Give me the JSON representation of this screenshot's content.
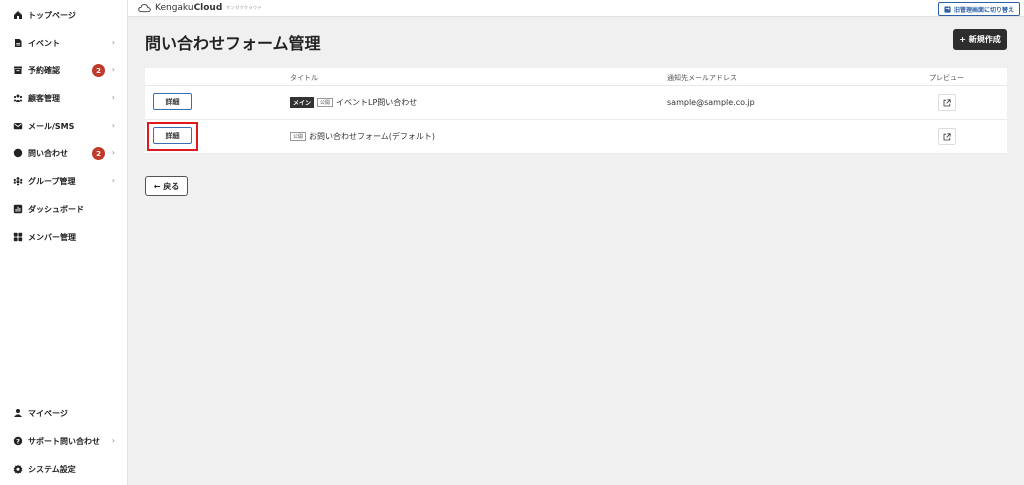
{
  "sidebar": {
    "items": [
      {
        "label": "トップページ",
        "icon": "home-icon"
      },
      {
        "label": "イベント",
        "icon": "document-icon"
      },
      {
        "label": "予約確認",
        "icon": "box-icon",
        "badge": "2"
      },
      {
        "label": "顧客管理",
        "icon": "users-icon"
      },
      {
        "label": "メール/SMS",
        "icon": "mail-icon"
      },
      {
        "label": "問い合わせ",
        "icon": "chat-icon",
        "badge": "2"
      },
      {
        "label": "グループ管理",
        "icon": "group-icon"
      },
      {
        "label": "ダッシュボード",
        "icon": "chart-icon"
      },
      {
        "label": "メンバー管理",
        "icon": "grid-icon"
      }
    ],
    "bottom_items": [
      {
        "label": "マイページ",
        "icon": "person-icon"
      },
      {
        "label": "サポート問い合わせ",
        "icon": "help-icon"
      },
      {
        "label": "システム設定",
        "icon": "gear-icon"
      }
    ]
  },
  "header": {
    "logo_prefix": "Kengaku",
    "logo_bold": "Cloud",
    "logo_sub": "ケンガククラウド",
    "switch_label": "旧管理画面に切り替え"
  },
  "main": {
    "title": "問い合わせフォーム管理",
    "new_button": "+ 新規作成",
    "columns": {
      "title": "タイトル",
      "email": "通知先メールアドレス",
      "preview": "プレビュー"
    },
    "rows": [
      {
        "detail": "詳細",
        "tag_main": "メイン",
        "tag_public": "公開",
        "title": "イベントLP問い合わせ",
        "email": "sample@sample.co.jp"
      },
      {
        "detail": "詳細",
        "tag_public": "公開",
        "title": "お問い合わせフォーム(デフォルト)",
        "email": ""
      }
    ],
    "back_button": "← 戻る"
  },
  "colors": {
    "badge": "#c0392b",
    "highlight": "#e0191e",
    "accent": "#2d5fa8",
    "dark_button": "#2d2d2d"
  }
}
